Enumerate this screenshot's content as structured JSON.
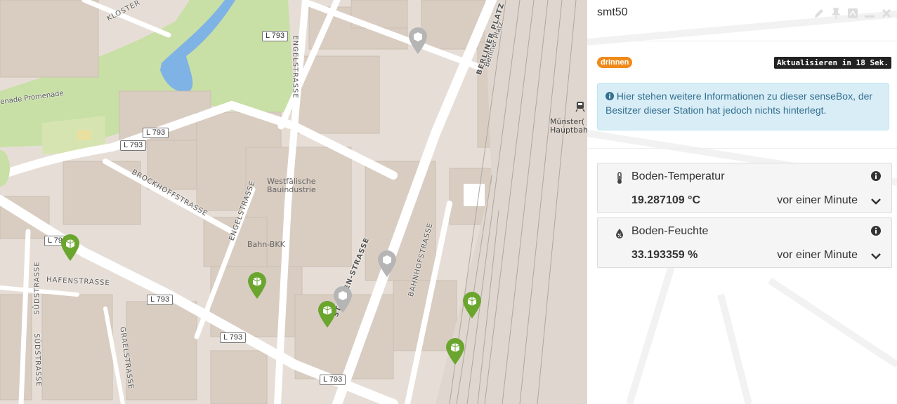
{
  "map": {
    "road_labels": [
      "L 793",
      "L 793",
      "L 793",
      "L 79",
      "L 793",
      "L 793",
      "L 793"
    ],
    "streets": {
      "kloster": "KLOSTER",
      "engelstrasse_top": "ENGELSTRASSE",
      "engelstrasse_mid": "ENGELSTRASSE",
      "promenade": "enade Promenade",
      "berliner_platz": "BERLINER PLATZ",
      "berliner_platz_small": "Berliner Platz",
      "brockhoff": "BROCKHOFFSTRASSE",
      "hafen": "HAFENSTRASSE",
      "sued1": "SÜDSTRASSE",
      "sued2": "SÜDSTRASSE",
      "grael": "GRAELSTRASSE",
      "steuben": "STEUBEN-STRASSE",
      "bahnhof": "BAHNHOFSTRASSE"
    },
    "pois": {
      "westfaelische": "Westfälische\nBauindustrie",
      "bahn_bkk": "Bahn-BKK",
      "hbf": "Münster(\nHauptbahn"
    },
    "colors": {
      "active_marker": "#6aa52e",
      "inactive_marker": "#b5b5b5",
      "park": "#c8dfa6",
      "water": "#7fb2e5"
    }
  },
  "panel": {
    "title": "smt50",
    "exposure_badge": "drinnen",
    "refresh_badge": "Aktualisieren in 18 Sek.",
    "info_text": "Hier stehen weitere Informationen zu dieser senseBox, der Besitzer dieser Station hat jedoch nichts hinterlegt.",
    "controls": [
      "edit-icon",
      "pin-icon",
      "compare-icon",
      "minimize-icon",
      "close-icon"
    ],
    "sensors": [
      {
        "name": "Boden-Temperatur",
        "value": "19.287109 °C",
        "time": "vor einer Minute",
        "icon": "thermometer-icon"
      },
      {
        "name": "Boden-Feuchte",
        "value": "33.193359 %",
        "time": "vor einer Minute",
        "icon": "humidity-icon"
      }
    ],
    "colors": {
      "badge_orange": "#ef8a1a",
      "alert_bg": "#d9edf7",
      "alert_text": "#31708f"
    }
  }
}
